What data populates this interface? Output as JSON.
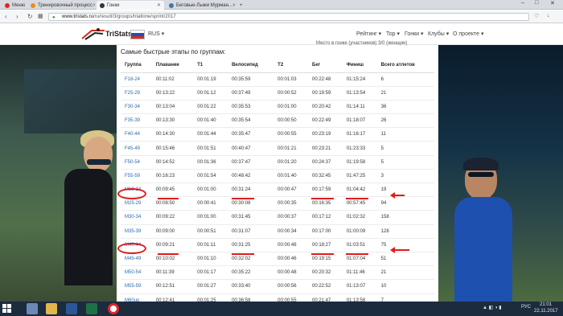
{
  "browser": {
    "tabs": [
      {
        "label": "Меню",
        "color": "#e0242c"
      },
      {
        "label": "Тренировочный процесс",
        "color": "#f08a1c"
      },
      {
        "label": "Гонки",
        "color": "#333333"
      },
      {
        "label": "Беговые-Лыжи Мурман...",
        "color": "#4a76a8"
      }
    ],
    "url_host": "www.tristats.ru",
    "url_path": "/ru/result/3/groups/triatlone/sprint/2017",
    "controls": {
      "minimize": "–",
      "maximize": "□",
      "close": "✕"
    }
  },
  "site": {
    "brand": "TriStats",
    "language": "RUS ▾",
    "menu": [
      "Рейтинг ▾",
      "Тор ▾",
      "Гонки ▾",
      "Клубы ▾",
      "О проекте ▾"
    ],
    "clipped_text": "Место в гонке (участников) 3/0 (женщин)",
    "flag_colors": [
      "#ffffff",
      "#1f4fb3",
      "#d52b1e"
    ]
  },
  "table": {
    "title": "Самые быстрые этапы по группам:",
    "headers": [
      "Группа",
      "Плавание",
      "T1",
      "Велосипед",
      "T2",
      "Бег",
      "Финиш",
      "Всего атлетов"
    ],
    "rows": [
      [
        "F18-24",
        "00:11:02",
        "00:01:19",
        "00:35:59",
        "00:01:03",
        "00:22:48",
        "01:15:24",
        "6"
      ],
      [
        "F25-29",
        "00:13:22",
        "00:01:12",
        "00:37:49",
        "00:00:52",
        "00:19:59",
        "01:13:54",
        "21"
      ],
      [
        "F30-34",
        "00:13:04",
        "00:01:22",
        "00:35:53",
        "00:01:00",
        "00:20:42",
        "01:14:11",
        "36"
      ],
      [
        "F35-39",
        "00:13:30",
        "00:01:40",
        "00:35:54",
        "00:00:50",
        "00:22:49",
        "01:18:07",
        "26"
      ],
      [
        "F40-44",
        "00:14:30",
        "00:01:44",
        "00:35:47",
        "00:00:55",
        "00:23:19",
        "01:16:17",
        "11"
      ],
      [
        "F45-49",
        "00:15:46",
        "00:01:51",
        "00:40:47",
        "00:01:21",
        "00:23:21",
        "01:23:33",
        "5"
      ],
      [
        "F50-54",
        "00:14:52",
        "00:01:36",
        "00:37:47",
        "00:01:20",
        "00:24:37",
        "01:19:58",
        "5"
      ],
      [
        "F55-59",
        "00:16:23",
        "00:01:54",
        "00:48:42",
        "00:01:40",
        "00:32:45",
        "01:47:25",
        "3"
      ],
      [
        "M18-24",
        "00:09:45",
        "00:01:00",
        "00:31:24",
        "00:00:47",
        "00:17:59",
        "01:04:42",
        "19"
      ],
      [
        "M25-29",
        "00:08:50",
        "00:00:41",
        "00:30:08",
        "00:00:35",
        "00:16:35",
        "00:57:45",
        "94"
      ],
      [
        "M30-34",
        "00:09:22",
        "00:01:00",
        "00:31:45",
        "00:00:37",
        "00:17:12",
        "01:02:32",
        "158"
      ],
      [
        "M35-39",
        "00:09:00",
        "00:00:51",
        "00:31:07",
        "00:00:34",
        "00:17:00",
        "01:00:09",
        "128"
      ],
      [
        "M40-44",
        "00:09:21",
        "00:01:11",
        "00:31:25",
        "00:00:48",
        "00:18:27",
        "01:03:51",
        "75"
      ],
      [
        "M45-49",
        "00:10:02",
        "00:01:10",
        "00:32:02",
        "00:00:46",
        "00:19:15",
        "01:07:04",
        "51"
      ],
      [
        "M50-54",
        "00:11:39",
        "00:01:17",
        "00:35:22",
        "00:00:48",
        "00:20:32",
        "01:11:46",
        "21"
      ],
      [
        "M55-59",
        "00:12:51",
        "00:01:27",
        "00:33:40",
        "00:00:56",
        "00:22:52",
        "01:13:07",
        "10"
      ],
      [
        "M60up",
        "00:12:41",
        "00:01:25",
        "00:36:58",
        "00:00:55",
        "00:21:47",
        "01:13:58",
        "7"
      ]
    ]
  },
  "taskbar": {
    "tray_lang": "РУС",
    "time": "21:01",
    "date": "22.11.2017"
  }
}
